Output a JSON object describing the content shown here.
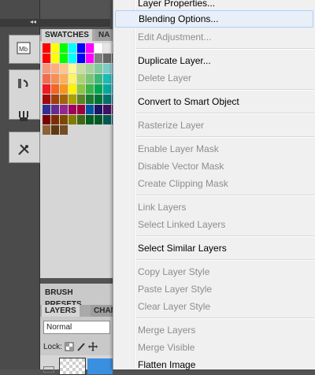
{
  "panels": {
    "collapse_glyph": "◂◂",
    "swatches_tab": "SWATCHES",
    "swatches_tab_cut": "NA",
    "brush_presets_tab": "BRUSH PRESETS",
    "layers_tab": "LAYERS",
    "channels_tab_cut": "CHANN",
    "blend_mode_value": "Normal",
    "lock_label": "Lock:",
    "strip_icons": [
      "mini-bridge-icon",
      "history-icon",
      "actions-icon",
      "tools-icon"
    ],
    "strip_icon_1_text": "Mb"
  },
  "swatches": {
    "colors": [
      "#ff0000",
      "#ffff00",
      "#00ff00",
      "#00ffff",
      "#0000ff",
      "#ff00ff",
      "#ffffff",
      "#e6e6e6",
      "#d9d9d9",
      "#ff0000",
      "#ffff00",
      "#00ff00",
      "#00ffff",
      "#0000ff",
      "#ff00ff",
      "#808080",
      "#666666",
      "#4d4d4d",
      "#f7977a",
      "#fbad82",
      "#fdc68c",
      "#fff799",
      "#c6df9c",
      "#a4d49d",
      "#81ca9d",
      "#7bcdc9",
      "#6ccff7",
      "#f26c4f",
      "#f68e56",
      "#fbaf5a",
      "#fff467",
      "#acd372",
      "#7cc576",
      "#3bb878",
      "#1abbb4",
      "#00bff3",
      "#ed1c24",
      "#f26522",
      "#f7941d",
      "#fff200",
      "#8dc63f",
      "#39b54a",
      "#00a651",
      "#00a99d",
      "#00aeef",
      "#9e0b0f",
      "#a0410d",
      "#a3620a",
      "#aba000",
      "#598527",
      "#197b30",
      "#007236",
      "#00746b",
      "#0076a3",
      "#790000",
      "#7b2e00",
      "#7d4900",
      "#827b00",
      "#406618",
      "#005e20",
      "#005826",
      "#005952",
      "#005b7f",
      "#8c6239",
      "#603913",
      "#754c24"
    ],
    "extra_row": [
      "#2e3192",
      "#662d91",
      "#92278f",
      "#9e005d",
      "#9e0039",
      "#0054a6",
      "#1b1464",
      "#440e62",
      "#630460"
    ]
  },
  "context_menu": {
    "items": [
      {
        "label": "Layer Properties...",
        "enabled": true
      },
      {
        "label": "Blending Options...",
        "enabled": true,
        "highlighted": true
      },
      {
        "label": "Edit Adjustment...",
        "enabled": false
      },
      {
        "label": "Duplicate Layer...",
        "enabled": true
      },
      {
        "label": "Delete Layer",
        "enabled": false
      },
      {
        "label": "Convert to Smart Object",
        "enabled": true
      },
      {
        "label": "Rasterize Layer",
        "enabled": false
      },
      {
        "label": "Enable Layer Mask",
        "enabled": false
      },
      {
        "label": "Disable Vector Mask",
        "enabled": false
      },
      {
        "label": "Create Clipping Mask",
        "enabled": false
      },
      {
        "label": "Link Layers",
        "enabled": false
      },
      {
        "label": "Select Linked Layers",
        "enabled": false
      },
      {
        "label": "Select Similar Layers",
        "enabled": true
      },
      {
        "label": "Copy Layer Style",
        "enabled": false
      },
      {
        "label": "Paste Layer Style",
        "enabled": false
      },
      {
        "label": "Clear Layer Style",
        "enabled": false
      },
      {
        "label": "Merge Layers",
        "enabled": false
      },
      {
        "label": "Merge Visible",
        "enabled": false
      },
      {
        "label": "Flatten Image",
        "enabled": true
      }
    ]
  }
}
